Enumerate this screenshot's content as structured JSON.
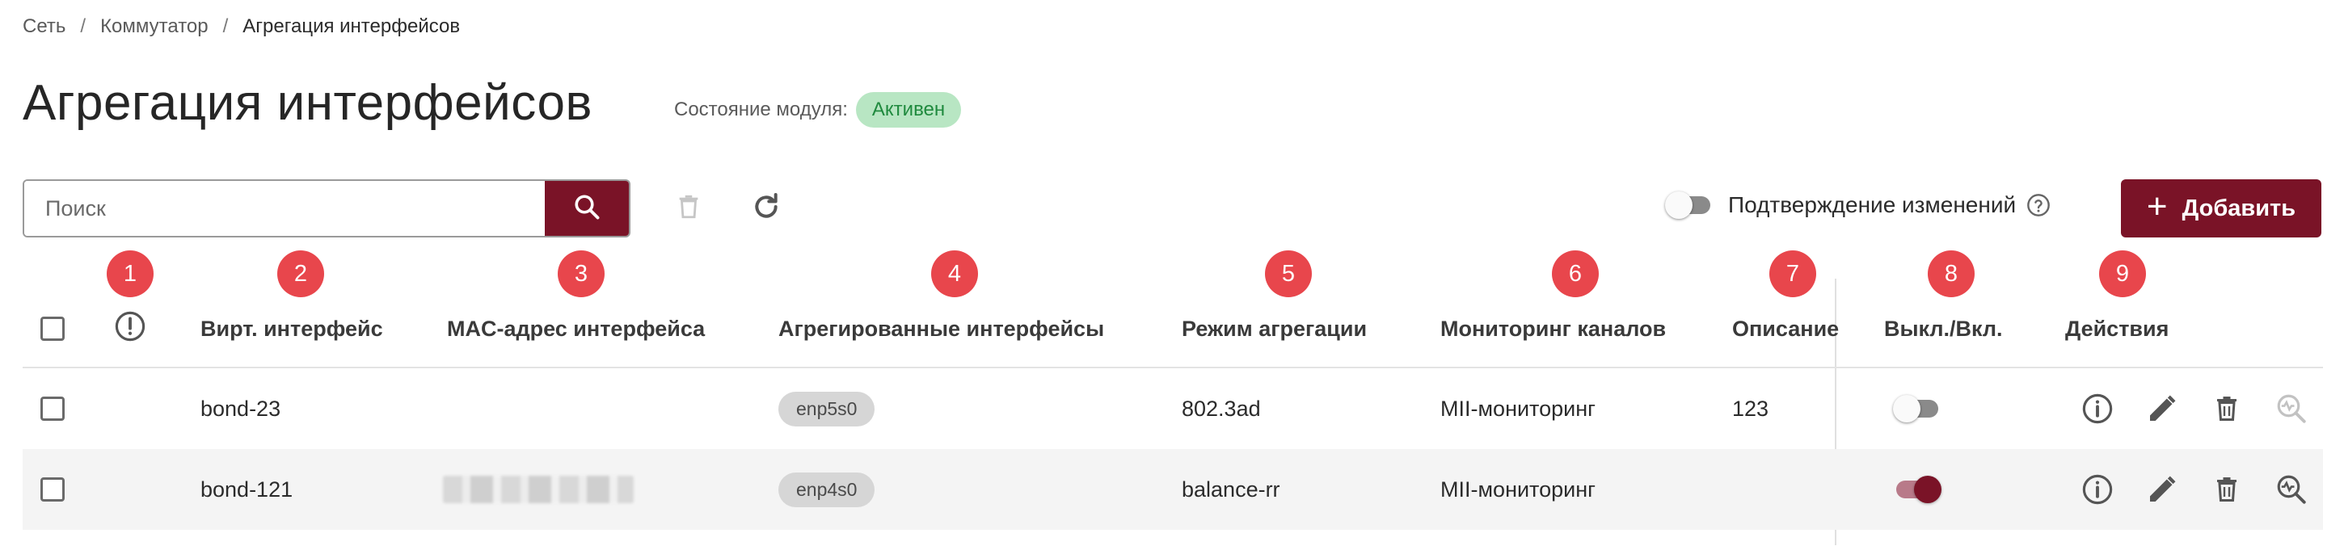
{
  "breadcrumb": {
    "items": [
      "Сеть",
      "Коммутатор"
    ],
    "current": "Агрегация интерфейсов",
    "separator": "/"
  },
  "page": {
    "title": "Агрегация интерфейсов",
    "module_state_label": "Состояние модуля:",
    "module_state_value": "Активен"
  },
  "toolbar": {
    "search_placeholder": "Поиск",
    "confirm_changes_label": "Подтверждение изменений",
    "confirm_changes_enabled": false,
    "add_label": "Добавить"
  },
  "markers": [
    "1",
    "2",
    "3",
    "4",
    "5",
    "6",
    "7",
    "8",
    "9"
  ],
  "table": {
    "columns": [
      "Вирт. интерфейс",
      "MAC-адрес интерфейса",
      "Агрегированные интерфейсы",
      "Режим агрегации",
      "Мониторинг каналов",
      "Описание",
      "Выкл./Вкл.",
      "Действия"
    ],
    "rows": [
      {
        "interface": "bond-23",
        "mac": "",
        "aggregated": "enp5s0",
        "mode": "802.3ad",
        "monitoring": "MII-мониторинг",
        "description": "123",
        "enabled": false
      },
      {
        "interface": "bond-121",
        "mac": "",
        "aggregated": "enp4s0",
        "mode": "balance-rr",
        "monitoring": "MII-мониторинг",
        "description": "",
        "enabled": true
      }
    ]
  },
  "colors": {
    "accent": "#7a1327",
    "marker": "#e8464c",
    "status_bg": "#b8e6c3",
    "status_text": "#1f8a3e"
  },
  "icons": {
    "search": "search-icon",
    "delete": "trash-icon",
    "refresh": "refresh-icon",
    "help": "help-circle-icon",
    "add": "plus-icon",
    "info": "info-icon",
    "edit": "pencil-icon",
    "diagnostics": "search-pulse-icon",
    "status_column": "alert-circle-icon"
  }
}
